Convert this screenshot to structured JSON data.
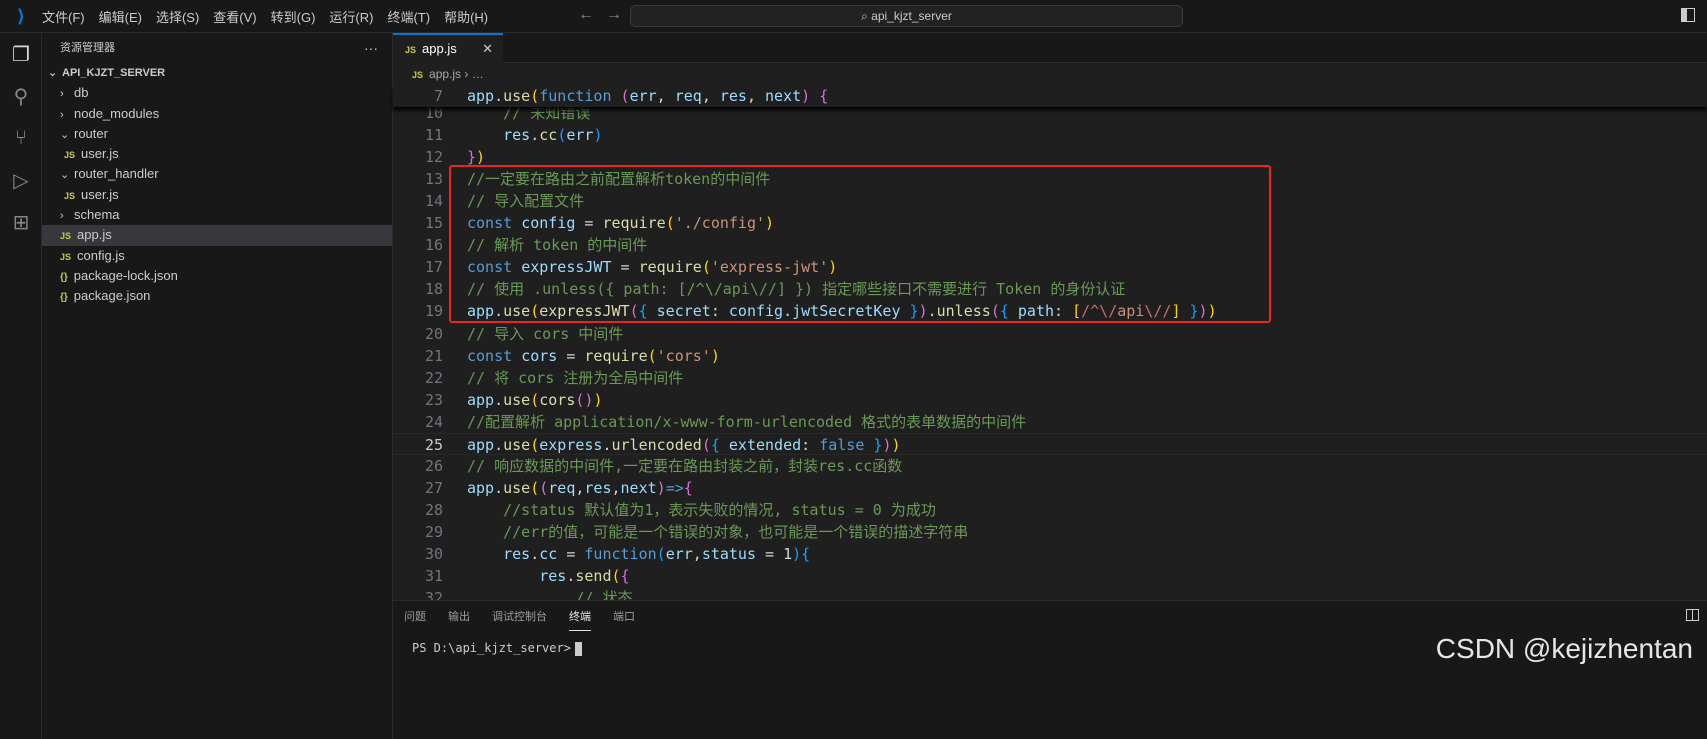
{
  "menu": [
    "文件(F)",
    "编辑(E)",
    "选择(S)",
    "查看(V)",
    "转到(G)",
    "运行(R)",
    "终端(T)",
    "帮助(H)"
  ],
  "search": "api_kjzt_server",
  "sidebar": {
    "title": "资源管理器",
    "more": "···",
    "root": "API_KJZT_SERVER",
    "items": [
      {
        "label": "db",
        "type": "folder",
        "open": false,
        "depth": 1
      },
      {
        "label": "node_modules",
        "type": "folder",
        "open": false,
        "depth": 1
      },
      {
        "label": "router",
        "type": "folder",
        "open": true,
        "depth": 1
      },
      {
        "label": "user.js",
        "type": "js",
        "depth": 2
      },
      {
        "label": "router_handler",
        "type": "folder",
        "open": true,
        "depth": 1
      },
      {
        "label": "user.js",
        "type": "js",
        "depth": 2
      },
      {
        "label": "schema",
        "type": "folder",
        "open": false,
        "depth": 1
      },
      {
        "label": "app.js",
        "type": "js",
        "depth": 1,
        "selected": true
      },
      {
        "label": "config.js",
        "type": "js",
        "depth": 1
      },
      {
        "label": "package-lock.json",
        "type": "json",
        "depth": 1
      },
      {
        "label": "package.json",
        "type": "json",
        "depth": 1
      }
    ]
  },
  "tab": {
    "label": "app.js",
    "close": "✕"
  },
  "breadcrumb": {
    "file": "app.js",
    "rest": "…"
  },
  "sticky_line": {
    "n": "7",
    "tokens": [
      [
        "app",
        "v"
      ],
      [
        ".",
        "p"
      ],
      [
        "use",
        "f"
      ],
      [
        "(",
        "b1"
      ],
      [
        "function",
        "k"
      ],
      [
        " ",
        "p"
      ],
      [
        "(",
        "b2"
      ],
      [
        "err",
        "v"
      ],
      [
        ", ",
        "p"
      ],
      [
        "req",
        "v"
      ],
      [
        ", ",
        "p"
      ],
      [
        "res",
        "v"
      ],
      [
        ", ",
        "p"
      ],
      [
        "next",
        "v"
      ],
      [
        ")",
        "b2"
      ],
      [
        " ",
        "p"
      ],
      [
        "{",
        "b2"
      ]
    ]
  },
  "current_line": "25",
  "code_lines": [
    {
      "n": "10",
      "tokens": [
        [
          "    // 未知错误",
          "c"
        ]
      ]
    },
    {
      "n": "11",
      "tokens": [
        [
          "    ",
          "p"
        ],
        [
          "res",
          "v"
        ],
        [
          ".",
          "p"
        ],
        [
          "cc",
          "f"
        ],
        [
          "(",
          "b3"
        ],
        [
          "err",
          "v"
        ],
        [
          ")",
          "b3"
        ]
      ]
    },
    {
      "n": "12",
      "tokens": [
        [
          "}",
          "b2"
        ],
        [
          ")",
          "b1"
        ]
      ]
    },
    {
      "n": "13",
      "tokens": [
        [
          "//一定要在路由之前配置解析token的中间件",
          "c"
        ]
      ]
    },
    {
      "n": "14",
      "tokens": [
        [
          "// 导入配置文件",
          "c"
        ]
      ]
    },
    {
      "n": "15",
      "tokens": [
        [
          "const",
          "k"
        ],
        [
          " ",
          "p"
        ],
        [
          "config",
          "v"
        ],
        [
          " = ",
          "p"
        ],
        [
          "require",
          "f"
        ],
        [
          "(",
          "b1"
        ],
        [
          "'./config'",
          "s"
        ],
        [
          ")",
          "b1"
        ]
      ]
    },
    {
      "n": "16",
      "tokens": [
        [
          "// 解析 token 的中间件",
          "c"
        ]
      ]
    },
    {
      "n": "17",
      "tokens": [
        [
          "const",
          "k"
        ],
        [
          " ",
          "p"
        ],
        [
          "expressJWT",
          "v"
        ],
        [
          " = ",
          "p"
        ],
        [
          "require",
          "f"
        ],
        [
          "(",
          "b1"
        ],
        [
          "'express-jwt'",
          "s"
        ],
        [
          ")",
          "b1"
        ]
      ]
    },
    {
      "n": "18",
      "tokens": [
        [
          "// 使用 .unless({ path: [/^\\/api\\//] }) 指定哪些接口不需要进行 Token 的身份认证",
          "c"
        ]
      ]
    },
    {
      "n": "19",
      "tokens": [
        [
          "app",
          "v"
        ],
        [
          ".",
          "p"
        ],
        [
          "use",
          "f"
        ],
        [
          "(",
          "b1"
        ],
        [
          "expressJWT",
          "f"
        ],
        [
          "(",
          "b2"
        ],
        [
          "{",
          "b3"
        ],
        [
          " ",
          "p"
        ],
        [
          "secret",
          "v"
        ],
        [
          ": ",
          "p"
        ],
        [
          "config",
          "v"
        ],
        [
          ".",
          "p"
        ],
        [
          "jwtSecretKey",
          "v"
        ],
        [
          " ",
          "p"
        ],
        [
          "}",
          "b3"
        ],
        [
          ")",
          "b2"
        ],
        [
          ".",
          "p"
        ],
        [
          "unless",
          "f"
        ],
        [
          "(",
          "b2"
        ],
        [
          "{",
          "b3"
        ],
        [
          " ",
          "p"
        ],
        [
          "path",
          "v"
        ],
        [
          ": ",
          "p"
        ],
        [
          "[",
          "b1"
        ],
        [
          "/^\\/",
          "r"
        ],
        [
          "api",
          "s"
        ],
        [
          "\\//",
          "r"
        ],
        [
          "]",
          "b1"
        ],
        [
          " ",
          "p"
        ],
        [
          "}",
          "b3"
        ],
        [
          ")",
          "b2"
        ],
        [
          ")",
          "b1"
        ]
      ]
    },
    {
      "n": "20",
      "tokens": [
        [
          "// 导入 cors 中间件",
          "c"
        ]
      ]
    },
    {
      "n": "21",
      "tokens": [
        [
          "const",
          "k"
        ],
        [
          " ",
          "p"
        ],
        [
          "cors",
          "v"
        ],
        [
          " = ",
          "p"
        ],
        [
          "require",
          "f"
        ],
        [
          "(",
          "b1"
        ],
        [
          "'cors'",
          "s"
        ],
        [
          ")",
          "b1"
        ]
      ]
    },
    {
      "n": "22",
      "tokens": [
        [
          "// 将 cors 注册为全局中间件",
          "c"
        ]
      ]
    },
    {
      "n": "23",
      "tokens": [
        [
          "app",
          "v"
        ],
        [
          ".",
          "p"
        ],
        [
          "use",
          "f"
        ],
        [
          "(",
          "b1"
        ],
        [
          "cors",
          "f"
        ],
        [
          "(",
          "b2"
        ],
        [
          ")",
          "b2"
        ],
        [
          ")",
          "b1"
        ]
      ]
    },
    {
      "n": "24",
      "tokens": [
        [
          "//配置解析 application/x-www-form-urlencoded 格式的表单数据的中间件",
          "c"
        ]
      ]
    },
    {
      "n": "25",
      "tokens": [
        [
          "app",
          "v"
        ],
        [
          ".",
          "p"
        ],
        [
          "use",
          "f"
        ],
        [
          "(",
          "b1"
        ],
        [
          "express",
          "v"
        ],
        [
          ".",
          "p"
        ],
        [
          "urlencoded",
          "f"
        ],
        [
          "(",
          "b2"
        ],
        [
          "{",
          "b3"
        ],
        [
          " ",
          "p"
        ],
        [
          "extended",
          "v"
        ],
        [
          ": ",
          "p"
        ],
        [
          "false",
          "k"
        ],
        [
          " ",
          "p"
        ],
        [
          "}",
          "b3"
        ],
        [
          ")",
          "b2"
        ],
        [
          ")",
          "b1"
        ]
      ]
    },
    {
      "n": "26",
      "tokens": [
        [
          "// 响应数据的中间件,一定要在路由封装之前，封装res.cc函数",
          "c"
        ]
      ]
    },
    {
      "n": "27",
      "tokens": [
        [
          "app",
          "v"
        ],
        [
          ".",
          "p"
        ],
        [
          "use",
          "f"
        ],
        [
          "(",
          "b1"
        ],
        [
          "(",
          "b2"
        ],
        [
          "req",
          "v"
        ],
        [
          ",",
          "p"
        ],
        [
          "res",
          "v"
        ],
        [
          ",",
          "p"
        ],
        [
          "next",
          "v"
        ],
        [
          ")",
          "b2"
        ],
        [
          "=>",
          "k"
        ],
        [
          "{",
          "b2"
        ]
      ]
    },
    {
      "n": "28",
      "tokens": [
        [
          "    //status 默认值为1，表示失败的情况, status = 0 为成功",
          "c"
        ]
      ]
    },
    {
      "n": "29",
      "tokens": [
        [
          "    //err的值，可能是一个错误的对象，也可能是一个错误的描述字符串",
          "c"
        ]
      ]
    },
    {
      "n": "30",
      "tokens": [
        [
          "    ",
          "p"
        ],
        [
          "res",
          "v"
        ],
        [
          ".",
          "p"
        ],
        [
          "cc",
          "v"
        ],
        [
          " = ",
          "p"
        ],
        [
          "function",
          "k"
        ],
        [
          "(",
          "b3"
        ],
        [
          "err",
          "v"
        ],
        [
          ",",
          "p"
        ],
        [
          "status",
          "v"
        ],
        [
          " = ",
          "p"
        ],
        [
          "1",
          "p"
        ],
        [
          ")",
          "b3"
        ],
        [
          "{",
          "b3"
        ]
      ]
    },
    {
      "n": "31",
      "tokens": [
        [
          "        ",
          "p"
        ],
        [
          "res",
          "v"
        ],
        [
          ".",
          "p"
        ],
        [
          "send",
          "f"
        ],
        [
          "(",
          "b1"
        ],
        [
          "{",
          "b2"
        ]
      ]
    },
    {
      "n": "32",
      "tokens": [
        [
          "            // 状态",
          "c"
        ]
      ]
    }
  ],
  "panel": {
    "tabs": [
      "问题",
      "输出",
      "调试控制台",
      "终端",
      "端口"
    ],
    "active_tab": "终端",
    "prompt": "PS D:\\api_kjzt_server>"
  },
  "watermark": "CSDN @kejizhentan",
  "colors": {
    "accent": "#0078d4",
    "highlight_box": "#e8261f"
  }
}
